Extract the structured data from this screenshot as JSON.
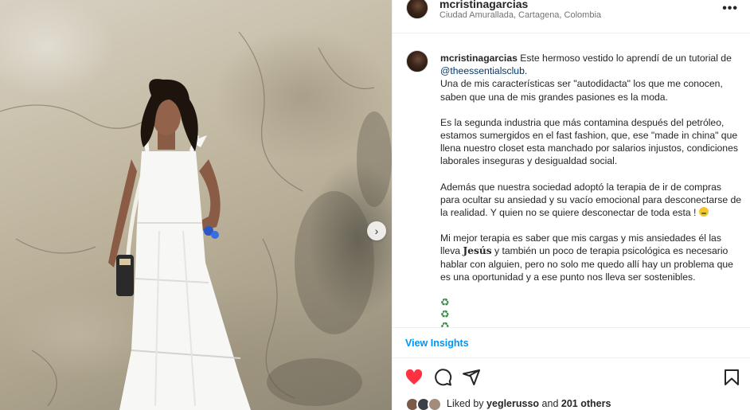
{
  "post": {
    "username": "mcristinagarcias",
    "location": "Ciudad Amurallada, Cartagena, Colombia",
    "more_icon": "more-horizontal-icon"
  },
  "caption": {
    "username": "mcristinagarcias",
    "intro": "Este hermoso vestido lo aprendí de un tutorial de",
    "mention": "@theessentialsclub",
    "after_mention": ".",
    "p1": "Una de mis características ser \"autodidacta\" los que me conocen, saben que una de mis grandes pasiones es la moda.",
    "p2": "Es la segunda industria que más contamina después del petróleo, estamos sumergidos en el fast fashion, que, ese \"made in china\" que llena nuestro closet esta manchado por salarios injustos, condiciones laborales inseguras y desigualdad social.",
    "p3": "Además que nuestra sociedad adoptó la terapia de ir de compras para ocultar su ansiedad y su vacío emocional para desconectarse de la realidad. Y quien no se quiere desconectar de toda esta !",
    "p4_start": "Mi mejor terapia es saber que mis cargas y mis ansiedades él las lleva",
    "p4_bold": "Jesús",
    "p4_end": "y también un poco de terapia psicológica es necesario hablar con alguien, pero no solo me quedo allí hay un problema que es una oportunidad y a ese punto nos lleva ser sostenibles."
  },
  "insights": {
    "label": "View Insights"
  },
  "actions": {
    "like_icon": "heart-filled-icon",
    "comment_icon": "comment-icon",
    "share_icon": "send-icon",
    "save_icon": "bookmark-icon",
    "like_color": "#ff3040"
  },
  "likes": {
    "prefix": "Liked by",
    "user": "yeglerusso",
    "middle": "and",
    "count": "201 others"
  },
  "colors": {
    "accent": "#0095f6",
    "mention": "#00376b",
    "text": "#262626",
    "muted": "#737373"
  }
}
